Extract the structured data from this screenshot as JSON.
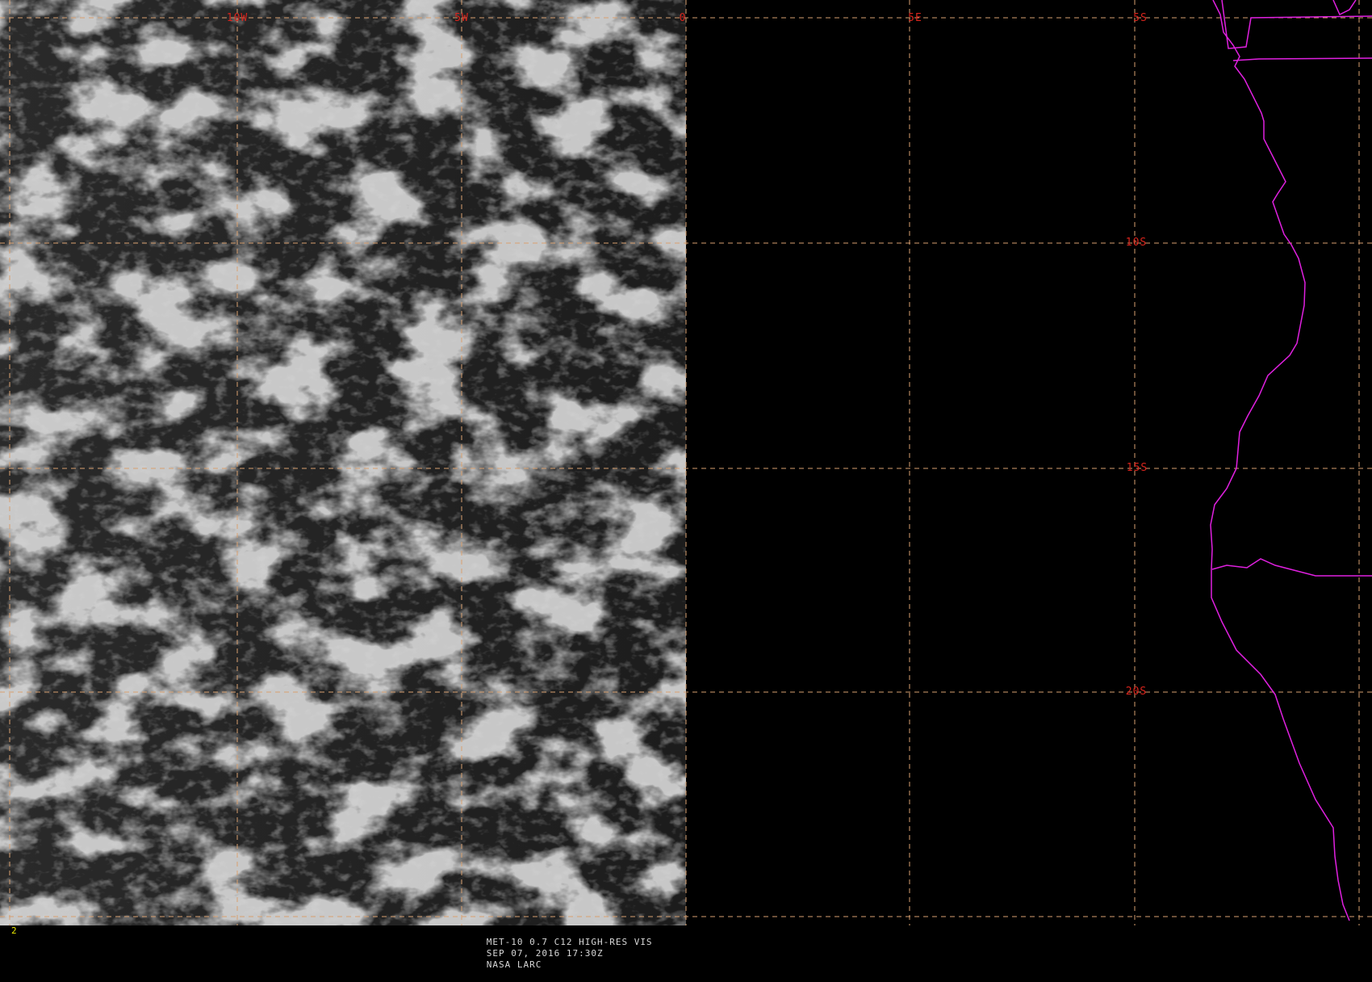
{
  "map": {
    "image_type": "satellite visible imagery",
    "region": "South-East Atlantic Ocean and south-western African coast",
    "colors": {
      "background": "#000000",
      "grid": "#d8a070",
      "grid_label": "#d8241c",
      "coastline": "#e020e0",
      "cloud": "#a8a8a8"
    },
    "grid": {
      "longitude_labels": [
        "10W",
        "5W",
        "0",
        "5E"
      ],
      "latitude_labels": [
        "5S",
        "10S",
        "15S",
        "20S"
      ]
    },
    "data_coverage": "imagery covers the area west of 0 (prime meridian); east of it is black (no data)"
  },
  "footer": {
    "frame_number": "2",
    "product": "MET-10 0.7 C12 HIGH-RES VIS",
    "datetime": "SEP 07, 2016 17:30Z",
    "source": "NASA LARC"
  }
}
